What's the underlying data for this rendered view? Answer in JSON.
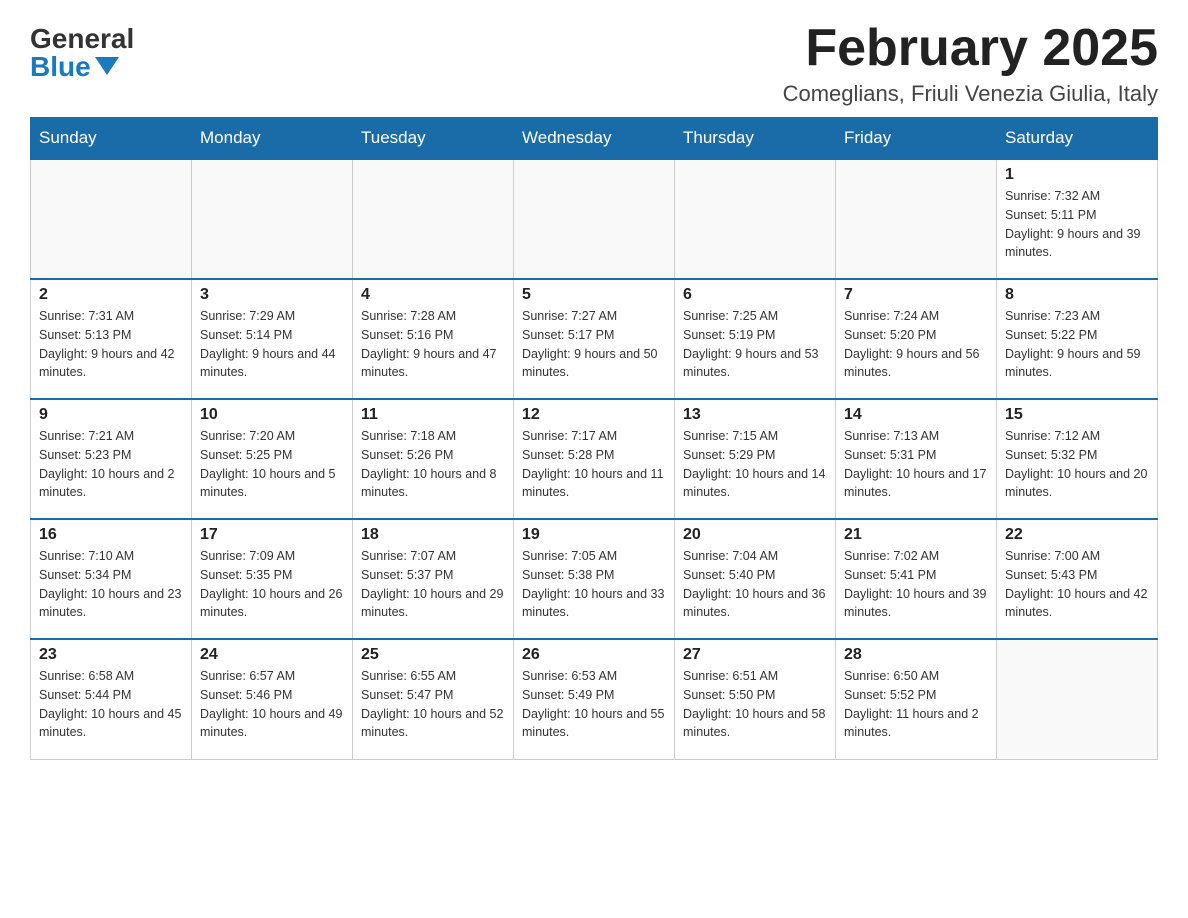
{
  "header": {
    "logo_general": "General",
    "logo_blue": "Blue",
    "month_title": "February 2025",
    "location": "Comeglians, Friuli Venezia Giulia, Italy"
  },
  "weekdays": [
    "Sunday",
    "Monday",
    "Tuesday",
    "Wednesday",
    "Thursday",
    "Friday",
    "Saturday"
  ],
  "weeks": [
    [
      {
        "day": "",
        "info": ""
      },
      {
        "day": "",
        "info": ""
      },
      {
        "day": "",
        "info": ""
      },
      {
        "day": "",
        "info": ""
      },
      {
        "day": "",
        "info": ""
      },
      {
        "day": "",
        "info": ""
      },
      {
        "day": "1",
        "info": "Sunrise: 7:32 AM\nSunset: 5:11 PM\nDaylight: 9 hours and 39 minutes."
      }
    ],
    [
      {
        "day": "2",
        "info": "Sunrise: 7:31 AM\nSunset: 5:13 PM\nDaylight: 9 hours and 42 minutes."
      },
      {
        "day": "3",
        "info": "Sunrise: 7:29 AM\nSunset: 5:14 PM\nDaylight: 9 hours and 44 minutes."
      },
      {
        "day": "4",
        "info": "Sunrise: 7:28 AM\nSunset: 5:16 PM\nDaylight: 9 hours and 47 minutes."
      },
      {
        "day": "5",
        "info": "Sunrise: 7:27 AM\nSunset: 5:17 PM\nDaylight: 9 hours and 50 minutes."
      },
      {
        "day": "6",
        "info": "Sunrise: 7:25 AM\nSunset: 5:19 PM\nDaylight: 9 hours and 53 minutes."
      },
      {
        "day": "7",
        "info": "Sunrise: 7:24 AM\nSunset: 5:20 PM\nDaylight: 9 hours and 56 minutes."
      },
      {
        "day": "8",
        "info": "Sunrise: 7:23 AM\nSunset: 5:22 PM\nDaylight: 9 hours and 59 minutes."
      }
    ],
    [
      {
        "day": "9",
        "info": "Sunrise: 7:21 AM\nSunset: 5:23 PM\nDaylight: 10 hours and 2 minutes."
      },
      {
        "day": "10",
        "info": "Sunrise: 7:20 AM\nSunset: 5:25 PM\nDaylight: 10 hours and 5 minutes."
      },
      {
        "day": "11",
        "info": "Sunrise: 7:18 AM\nSunset: 5:26 PM\nDaylight: 10 hours and 8 minutes."
      },
      {
        "day": "12",
        "info": "Sunrise: 7:17 AM\nSunset: 5:28 PM\nDaylight: 10 hours and 11 minutes."
      },
      {
        "day": "13",
        "info": "Sunrise: 7:15 AM\nSunset: 5:29 PM\nDaylight: 10 hours and 14 minutes."
      },
      {
        "day": "14",
        "info": "Sunrise: 7:13 AM\nSunset: 5:31 PM\nDaylight: 10 hours and 17 minutes."
      },
      {
        "day": "15",
        "info": "Sunrise: 7:12 AM\nSunset: 5:32 PM\nDaylight: 10 hours and 20 minutes."
      }
    ],
    [
      {
        "day": "16",
        "info": "Sunrise: 7:10 AM\nSunset: 5:34 PM\nDaylight: 10 hours and 23 minutes."
      },
      {
        "day": "17",
        "info": "Sunrise: 7:09 AM\nSunset: 5:35 PM\nDaylight: 10 hours and 26 minutes."
      },
      {
        "day": "18",
        "info": "Sunrise: 7:07 AM\nSunset: 5:37 PM\nDaylight: 10 hours and 29 minutes."
      },
      {
        "day": "19",
        "info": "Sunrise: 7:05 AM\nSunset: 5:38 PM\nDaylight: 10 hours and 33 minutes."
      },
      {
        "day": "20",
        "info": "Sunrise: 7:04 AM\nSunset: 5:40 PM\nDaylight: 10 hours and 36 minutes."
      },
      {
        "day": "21",
        "info": "Sunrise: 7:02 AM\nSunset: 5:41 PM\nDaylight: 10 hours and 39 minutes."
      },
      {
        "day": "22",
        "info": "Sunrise: 7:00 AM\nSunset: 5:43 PM\nDaylight: 10 hours and 42 minutes."
      }
    ],
    [
      {
        "day": "23",
        "info": "Sunrise: 6:58 AM\nSunset: 5:44 PM\nDaylight: 10 hours and 45 minutes."
      },
      {
        "day": "24",
        "info": "Sunrise: 6:57 AM\nSunset: 5:46 PM\nDaylight: 10 hours and 49 minutes."
      },
      {
        "day": "25",
        "info": "Sunrise: 6:55 AM\nSunset: 5:47 PM\nDaylight: 10 hours and 52 minutes."
      },
      {
        "day": "26",
        "info": "Sunrise: 6:53 AM\nSunset: 5:49 PM\nDaylight: 10 hours and 55 minutes."
      },
      {
        "day": "27",
        "info": "Sunrise: 6:51 AM\nSunset: 5:50 PM\nDaylight: 10 hours and 58 minutes."
      },
      {
        "day": "28",
        "info": "Sunrise: 6:50 AM\nSunset: 5:52 PM\nDaylight: 11 hours and 2 minutes."
      },
      {
        "day": "",
        "info": ""
      }
    ]
  ]
}
